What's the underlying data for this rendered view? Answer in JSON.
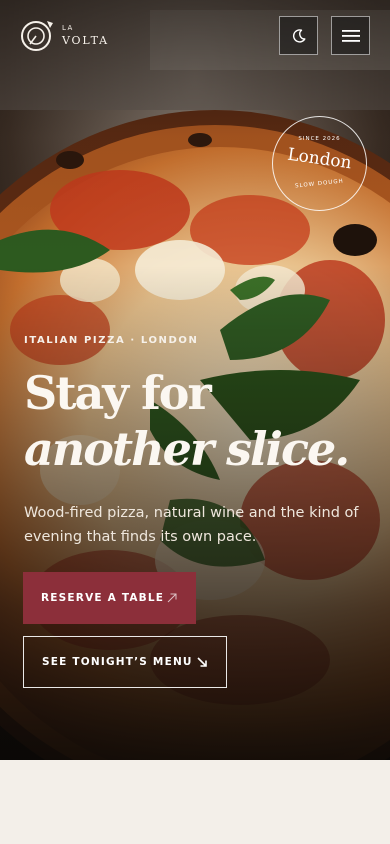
{
  "brand": {
    "small": "LA",
    "name": "VOLTA"
  },
  "header": {
    "theme_icon": "moon-icon",
    "menu_icon": "hamburger-menu-icon"
  },
  "badge": {
    "since": "SINCE 2026",
    "city": "London",
    "tagline": "SLOW DOUGH"
  },
  "hero": {
    "eyebrow": "ITALIAN PIZZA · LONDON",
    "headline_line1": "Stay for",
    "headline_line2": "another slice.",
    "lede": "Wood-fired pizza, natural wine and the kind of evening that finds its own pace.",
    "primary_cta": "RESERVE A TABLE",
    "primary_cta_icon": "arrow-up-right-icon",
    "secondary_cta": "SEE TONIGHT’S MENU",
    "secondary_cta_icon": "arrow-down-right-icon"
  },
  "colors": {
    "accent": "#8c2f3a",
    "cream": "#f3efe9",
    "dark": "#14100c"
  }
}
